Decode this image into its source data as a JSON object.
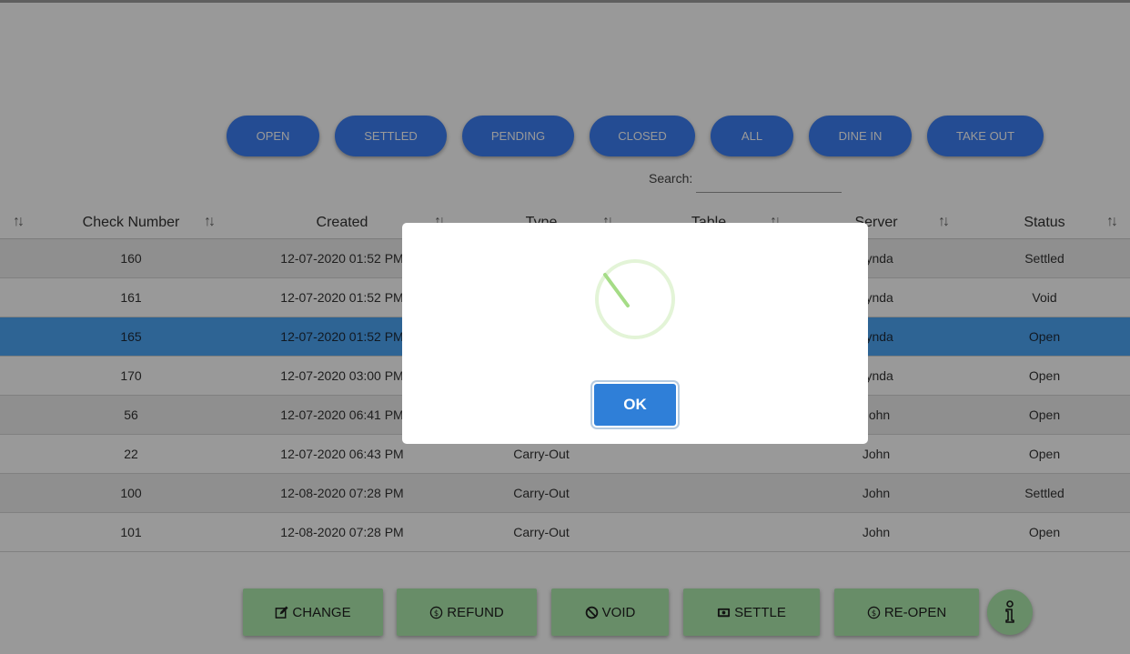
{
  "filters": [
    {
      "label": "OPEN"
    },
    {
      "label": "SETTLED"
    },
    {
      "label": "PENDING"
    },
    {
      "label": "CLOSED"
    },
    {
      "label": "ALL"
    },
    {
      "label": "DINE IN"
    },
    {
      "label": "TAKE OUT"
    }
  ],
  "search": {
    "label": "Search:",
    "value": ""
  },
  "table": {
    "sort_icon": "↑↓",
    "columns": {
      "check_number": "Check Number",
      "created": "Created",
      "type": "Type",
      "table": "Table",
      "server": "Server",
      "status": "Status"
    },
    "rows": [
      {
        "check": "160",
        "created": "12-07-2020 01:52 PM",
        "type": "",
        "table": "",
        "server": "Lynda",
        "status": "Settled"
      },
      {
        "check": "161",
        "created": "12-07-2020 01:52 PM",
        "type": "",
        "table": "",
        "server": "Lynda",
        "status": "Void"
      },
      {
        "check": "165",
        "created": "12-07-2020 01:52 PM",
        "type": "",
        "table": "",
        "server": "Lynda",
        "status": "Open"
      },
      {
        "check": "170",
        "created": "12-07-2020 03:00 PM",
        "type": "",
        "table": "",
        "server": "Lynda",
        "status": "Open"
      },
      {
        "check": "56",
        "created": "12-07-2020 06:41 PM",
        "type": "",
        "table": "",
        "server": "John",
        "status": "Open"
      },
      {
        "check": "22",
        "created": "12-07-2020 06:43 PM",
        "type": "Carry-Out",
        "table": "",
        "server": "John",
        "status": "Open"
      },
      {
        "check": "100",
        "created": "12-08-2020 07:28 PM",
        "type": "Carry-Out",
        "table": "",
        "server": "John",
        "status": "Settled"
      },
      {
        "check": "101",
        "created": "12-08-2020 07:28 PM",
        "type": "Carry-Out",
        "table": "",
        "server": "John",
        "status": "Open"
      }
    ]
  },
  "actions": {
    "change": "CHANGE",
    "refund": "REFUND",
    "void": "VOID",
    "settle": "SETTLE",
    "reopen": "RE-OPEN"
  },
  "modal": {
    "ok_label": "OK"
  },
  "colors": {
    "primary": "#3d7ff5",
    "selected_row": "#4ea7f7",
    "action_green": "#adebad",
    "ok_button": "#2f7fd8",
    "spinner": "#a5dc86"
  }
}
